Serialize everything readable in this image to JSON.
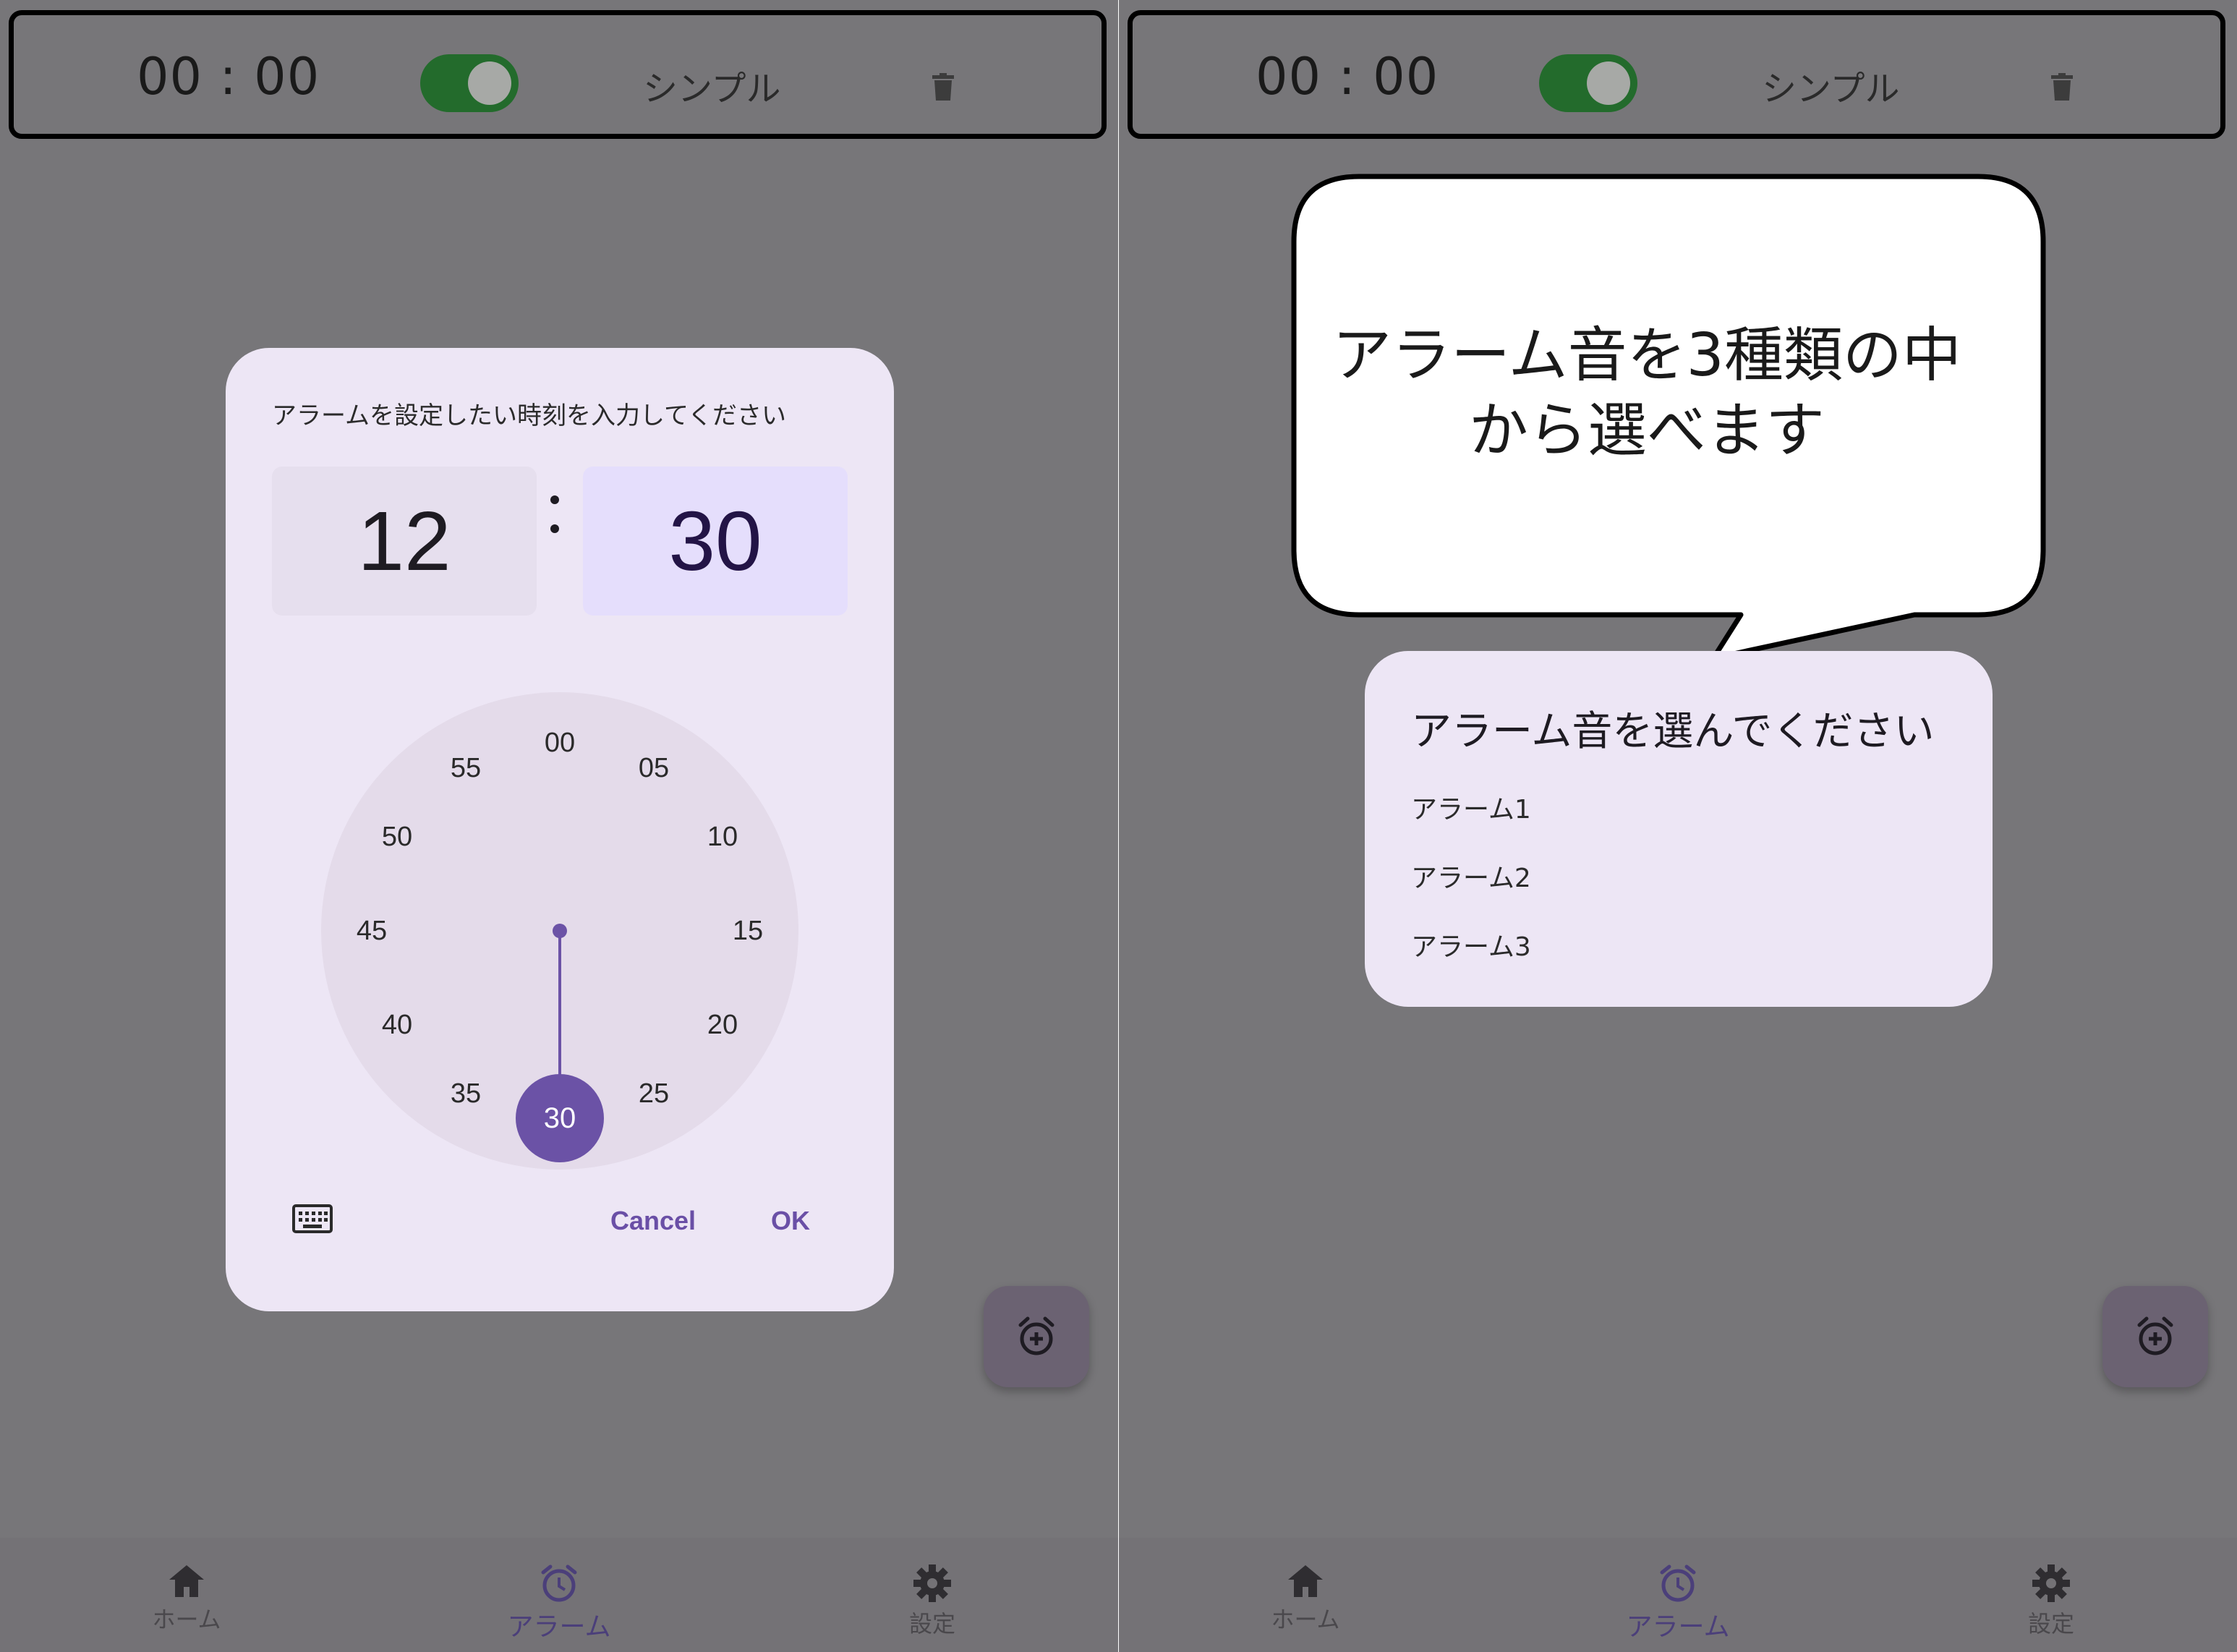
{
  "alarm_row": {
    "time": "00 : 00",
    "enabled": true,
    "type_label": "シンプル"
  },
  "time_picker": {
    "prompt": "アラームを設定したい時刻を入力してください",
    "hour": "12",
    "minute": "30",
    "dial_labels": [
      "00",
      "05",
      "10",
      "15",
      "20",
      "25",
      "30",
      "35",
      "40",
      "45",
      "50",
      "55"
    ],
    "selected_minute": "30",
    "cancel_label": "Cancel",
    "ok_label": "OK"
  },
  "callout": {
    "text_line1": "アラーム音を3種類の中",
    "text_line2": "から選べます"
  },
  "sound_dialog": {
    "title": "アラーム音を選んでください",
    "options": [
      "アラーム1",
      "アラーム2",
      "アラーム3"
    ]
  },
  "bottom_nav": {
    "items": [
      {
        "label": "ホーム",
        "icon": "home-icon"
      },
      {
        "label": "アラーム",
        "icon": "alarm-clock-icon",
        "active": true
      },
      {
        "label": "設定",
        "icon": "gear-icon"
      }
    ]
  },
  "colors": {
    "accent": "#6b52a6",
    "toggle_on": "#236b2c",
    "scrim": "#777679",
    "dialog_bg": "#ede6f5"
  }
}
